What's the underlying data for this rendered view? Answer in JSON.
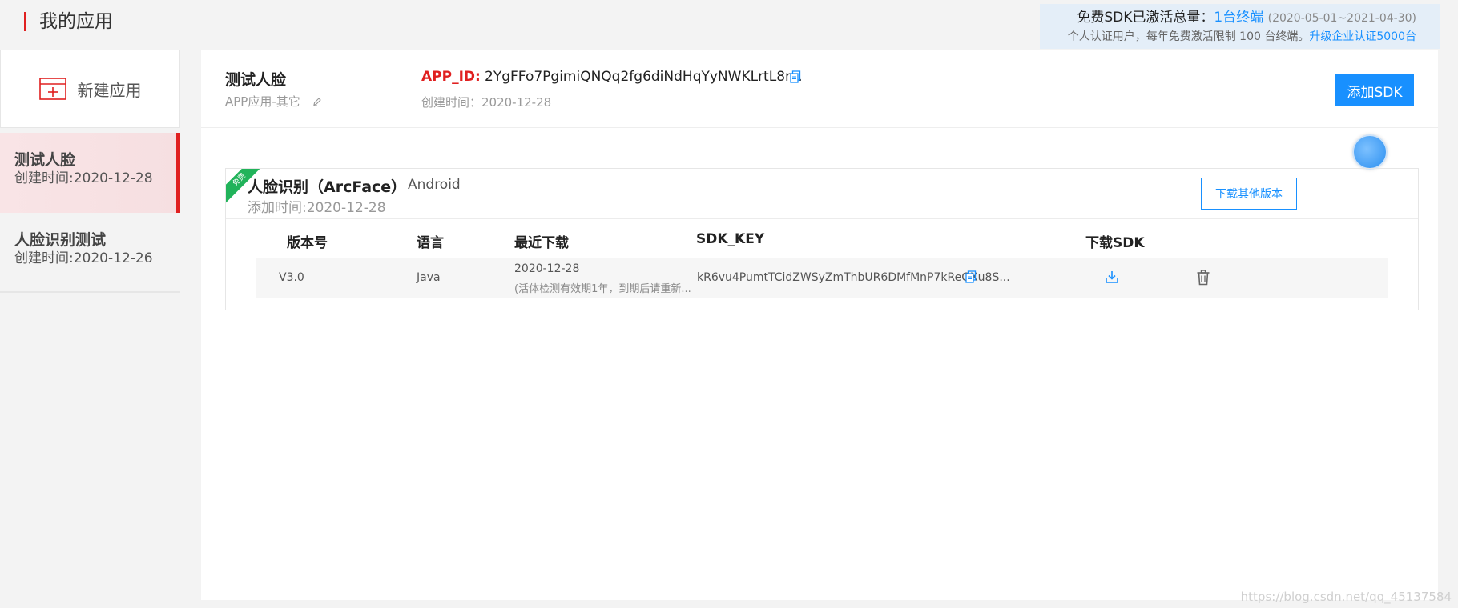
{
  "page": {
    "title": "我的应用"
  },
  "quota": {
    "label": "免费SDK已激活总量：",
    "count": "1台终端",
    "period": "(2020-05-01~2021-04-30)",
    "note": "个人认证用户，每年免费激活限制 100 台终端。",
    "upgrade_link": "升级企业认证5000台"
  },
  "sidebar": {
    "new_app_label": "新建应用",
    "items": [
      {
        "name": "测试人脸",
        "date": "创建时间:2020-12-28",
        "active": true
      },
      {
        "name": "人脸识别测试",
        "date": "创建时间:2020-12-26",
        "active": false
      }
    ]
  },
  "app": {
    "name": "测试人脸",
    "type": "APP应用-其它",
    "app_id_label": "APP_ID:",
    "app_id_value": "2YgFFo7PgimiQNQq2fg6diNdHqYyNWKLrtL8r...",
    "created": "创建时间：2020-12-28",
    "add_sdk_label": "添加SDK"
  },
  "sdk": {
    "free_badge": "免费",
    "title": "人脸识别（ArcFace）",
    "platform": "Android",
    "added": "添加时间:2020-12-28",
    "download_other_label": "下载其他版本",
    "columns": [
      "版本号",
      "语言",
      "最近下载",
      "SDK_KEY",
      "下载SDK"
    ],
    "rows": [
      {
        "version": "V3.0",
        "language": "Java",
        "recent_date": "2020-12-28",
        "recent_note": "(活体检测有效期1年，到期后请重新...",
        "sdk_key": "kR6vu4PumtTCidZWSyZmThbUR6DMfMnP7kReGXu8S..."
      }
    ]
  },
  "watermark": "https://blog.csdn.net/qq_45137584",
  "colors": {
    "accent": "#1890ff",
    "active": "#e02020",
    "free": "#21b35a"
  },
  "icons": [
    "new-app-icon",
    "pencil-icon",
    "copy-icon",
    "download-icon",
    "trash-icon"
  ]
}
